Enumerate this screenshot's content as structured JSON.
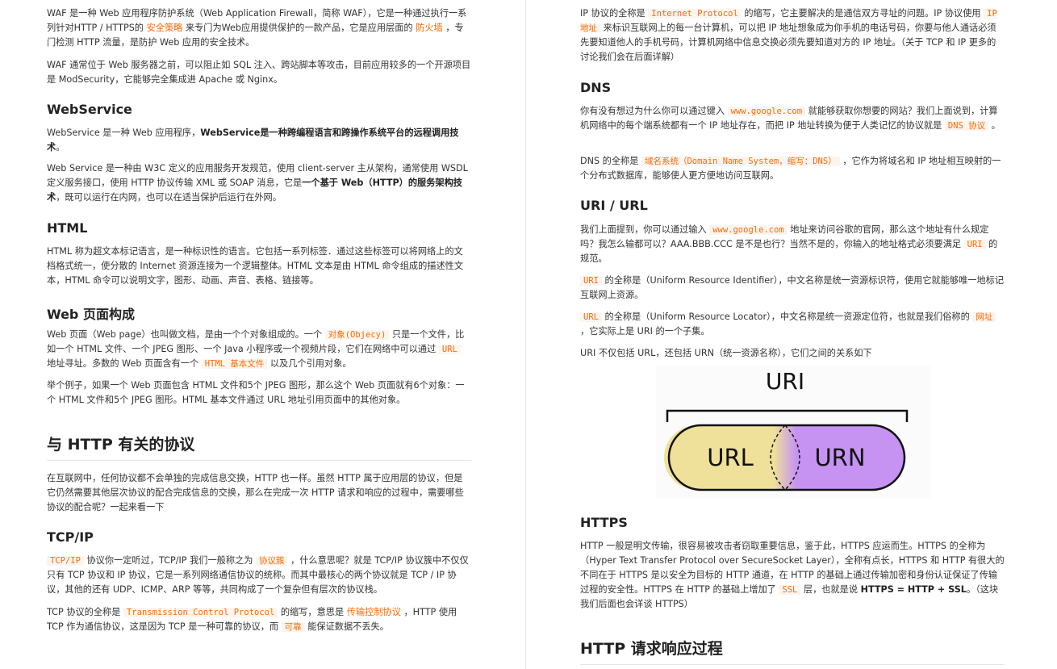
{
  "left": {
    "waf_p1": [
      "WAF 是一种 Web 应用程序防护系统（Web Application Firewall，简称 WAF），它是一种通过执行一系列针对HTTP / HTTPS的 ",
      "安全策略",
      " 来专门为Web应用提供保护的一款产品，它是应用层面的 ",
      "防火墙",
      " ，专门检测 HTTP 流量，是防护 Web 应用的安全技术。"
    ],
    "waf_p2": "WAF 通常位于 Web 服务器之前，可以阻止如 SQL 注入、跨站脚本等攻击，目前应用较多的一个开源项目是 ModSecurity，它能够完全集成进 Apache 或 Nginx。",
    "ws_title": "WebService",
    "ws_p1": [
      "WebService 是一种 Web 应用程序，",
      "WebService是一种跨编程语言和跨操作系统平台的远程调用技术",
      "。"
    ],
    "ws_p2": [
      "Web Service 是一种由 W3C 定义的应用服务开发规范，使用 client-server 主从架构，通常使用 WSDL 定义服务接口，使用 HTTP 协议传输 XML 或 SOAP 消息，它是",
      "一个基于 Web（HTTP）的服务架构技术",
      "，既可以运行在内网，也可以在适当保护后运行在外网。"
    ],
    "html_title": "HTML",
    "html_p": "HTML 称为超文本标记语言，是一种标识性的语言。它包括一系列标签．通过这些标签可以将网络上的文档格式统一，使分散的 Internet 资源连接为一个逻辑整体。HTML 文本是由 HTML 命令组成的描述性文本，HTML 命令可以说明文字，图形、动画、声音、表格、链接等。",
    "webpage_title": "Web 页面构成",
    "webpage_p1": [
      "Web 页面（Web page）也叫做文档，是由一个个对象组成的。一个 ",
      "对象(Objecy)",
      " 只是一个文件，比如一个 HTML 文件、一个 JPEG 图形、一个 Java 小程序或一个视频片段，它们在网络中可以通过 ",
      "URL",
      " 地址寻址。多数的 Web 页面含有一个 ",
      "HTML 基本文件",
      " 以及几个引用对象。"
    ],
    "webpage_p2": "举个例子，如果一个 Web 页面包含 HTML 文件和5个 JPEG 图形，那么这个 Web 页面就有6个对象：一个 HTML 文件和5个 JPEG 图形。HTML 基本文件通过 URL 地址引用页面中的其他对象。",
    "protocols_title": "与 HTTP 有关的协议",
    "protocols_p": "在互联网中，任何协议都不会单独的完成信息交换，HTTP 也一样。虽然 HTTP 属于应用层的协议，但是它仍然需要其他层次协议的配合完成信息的交换，那么在完成一次 HTTP 请求和响应的过程中，需要哪些协议的配合呢？一起来看一下",
    "tcpip_title": "TCP/IP",
    "tcpip_p1": [
      "TCP/IP",
      " 协议你一定听过，TCP/IP 我们一般称之为 ",
      "协议簇",
      " ，什么意思呢？就是 TCP/IP 协议簇中不仅仅只有 TCP 协议和 IP 协议，它是一系列网络通信协议的统称。而其中最核心的两个协议就是 TCP / IP 协议，其他的还有 UDP、ICMP、ARP 等等，共同构成了一个复杂但有层次的协议栈。"
    ],
    "tcpip_p2": [
      "TCP 协议的全称是 ",
      "Transmission Control Protocol",
      " 的缩写，意思是 ",
      "传输控制协议",
      " ，HTTP 使用 TCP 作为通信协议，这是因为 TCP 是一种可靠的协议，而 ",
      "可靠",
      " 能保证数据不丢失。"
    ]
  },
  "right": {
    "ip_p": [
      "IP 协议的全称是 ",
      "Internet Protocol",
      " 的缩写，它主要解决的是通信双方寻址的问题。IP 协议使用 ",
      "IP 地址",
      " 来标识互联网上的每一台计算机，可以把 IP 地址想象成为你手机的电话号码，你要与他人通话必须先要知道他人的手机号码，计算机网络中信息交换必须先要知道对方的 IP 地址。（关于 TCP 和 IP 更多的讨论我们会在后面详解）"
    ],
    "dns_title": "DNS",
    "dns_p1": [
      "你有没有想过为什么你可以通过键入 ",
      "www.google.com",
      " 就能够获取你想要的网站？我们上面说到，计算机网络中的每个端系统都有一个 IP 地址存在，而把 IP 地址转换为便于人类记忆的协议就是 ",
      "DNS 协议",
      " 。"
    ],
    "dns_p2": [
      "DNS 的全称是 ",
      "域名系统（Domain Name System，缩写：DNS）",
      " ，它作为将域名和 IP 地址相互映射的一个分布式数据库，能够使人更方便地访问互联网。"
    ],
    "uri_title": "URI / URL",
    "uri_p1": [
      "我们上面提到，你可以通过输入 ",
      "www.google.com",
      " 地址来访问谷歌的官网，那么这个地址有什么规定吗？我怎么输都可以？AAA.BBB.CCC 是不是也行？当然不是的，你输入的地址格式必须要满足 ",
      "URI",
      " 的规范。"
    ],
    "uri_p2": [
      "URI",
      " 的全称是（Uniform Resource Identifier），中文名称是统一资源标识符，使用它就能够唯一地标记互联网上资源。"
    ],
    "uri_p3": [
      "URL",
      " 的全称是（Uniform Resource Locator），中文名称是统一资源定位符，也就是我们俗称的 ",
      "网址",
      " ，它实际上是 URI 的一个子集。"
    ],
    "uri_p4": "URI 不仅包括 URL，还包括 URN（统一资源名称），它们之间的关系如下",
    "diagram": {
      "top": "URI",
      "left": "URL",
      "right": "URN",
      "url_color": "#f0e19a",
      "urn_color": "#c693f3"
    },
    "https_title": "HTTPS",
    "https_p": [
      "HTTP 一般是明文传输，很容易被攻击者窃取重要信息，鉴于此，HTTPS 应运而生。HTTPS 的全称为（Hyper Text Transfer Protocol over SecureSocket Layer），全称有点长，HTTPS 和 HTTP 有很大的不同在于 HTTPS 是以安全为目标的 HTTP 通道，在 HTTP 的基础上通过传输加密和身份认证保证了传输过程的安全性。HTTPS 在 HTTP 的基础上增加了 ",
      "SSL",
      " 层，也就是说 ",
      "HTTPS = HTTP + SSL",
      "。（这块我们后面也会详谈 HTTPS）"
    ],
    "process_title": "HTTP 请求响应过程"
  }
}
